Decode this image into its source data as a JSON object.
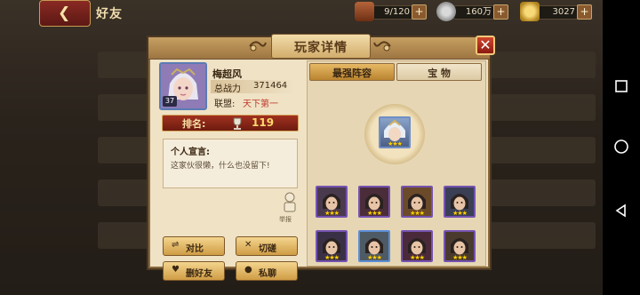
{
  "topbar": {
    "friends_title": "好友",
    "back_arrow": "❮",
    "resources": [
      {
        "icon": "treasure-chest-icon",
        "value": "9/120",
        "plus": "+"
      },
      {
        "icon": "silver-coin-icon",
        "value": "160万",
        "plus": "+"
      },
      {
        "icon": "ingot-icon",
        "value": "3027",
        "plus": "+"
      }
    ]
  },
  "dialog": {
    "title": "玩家详情",
    "close": "✕",
    "player": {
      "name": "梅超风",
      "level": "37",
      "power_label": "总战力",
      "power_value": "371464",
      "alliance_label": "联盟:",
      "alliance_value": "天下第一",
      "rank_label": "排名:",
      "rank_value": "119"
    },
    "declaration": {
      "title": "个人宣言:",
      "text": "这家伙很懒，什么也没留下!"
    },
    "report_label": "举报",
    "buttons": {
      "compare": "对比",
      "spar": "切磋",
      "delete_friend": "删好友",
      "private_chat": "私聊"
    },
    "tabs": [
      "最强阵容",
      "宝 物"
    ],
    "lineup": {
      "leader": {
        "stars": "★★★",
        "frame_color": "#6f8fc7"
      },
      "heroes": [
        {
          "stars": "★★★",
          "frame": "#7552b1",
          "bg": "#4a3a4e"
        },
        {
          "stars": "★★★",
          "frame": "#7552b1",
          "bg": "#4b2d3a"
        },
        {
          "stars": "★★★",
          "frame": "#7552b1",
          "bg": "#6b4a2a"
        },
        {
          "stars": "★★★",
          "frame": "#7552b1",
          "bg": "#3a3f55"
        },
        {
          "stars": "★★★",
          "frame": "#7552b1",
          "bg": "#3a3046"
        },
        {
          "stars": "★★★",
          "frame": "#5b8ed6",
          "bg": "#4e5a64"
        },
        {
          "stars": "★★★",
          "frame": "#7552b1",
          "bg": "#4a2a3a"
        },
        {
          "stars": "★★★",
          "frame": "#7552b1",
          "bg": "#4a3a2e"
        }
      ]
    }
  },
  "colors": {
    "dialog_bg": "#efe2c5",
    "rank_bar": "#a1311f",
    "button_gold": "#f4d58e",
    "alliance_red": "#c0392b"
  }
}
